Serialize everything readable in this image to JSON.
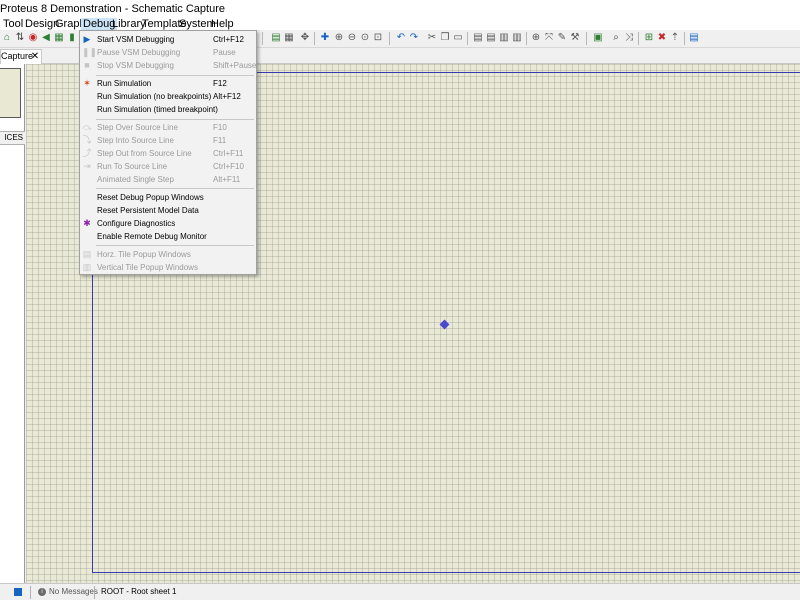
{
  "window": {
    "title": "Proteus 8 Demonstration - Schematic Capture"
  },
  "menubar": {
    "items": [
      {
        "label": "Tool"
      },
      {
        "label": "Design"
      },
      {
        "label": "Graph"
      },
      {
        "label": "Debug"
      },
      {
        "label": "Library"
      },
      {
        "label": "Template"
      },
      {
        "label": "System"
      },
      {
        "label": "Help"
      }
    ]
  },
  "tab": {
    "label": "Capture",
    "close_glyph": "✕"
  },
  "left_pane": {
    "devices_header": "ICES"
  },
  "debug_menu": {
    "items": [
      {
        "label": "Start VSM Debugging",
        "shortcut": "Ctrl+F12",
        "icon": "play-icon",
        "enabled": true
      },
      {
        "label": "Pause VSM Debugging",
        "shortcut": "Pause",
        "icon": "pause-icon",
        "enabled": false
      },
      {
        "label": "Stop VSM Debugging",
        "shortcut": "Shift+Pause",
        "icon": "stop-icon",
        "enabled": false
      },
      {
        "label": "Run Simulation",
        "shortcut": "F12",
        "icon": "run-simulation-icon",
        "enabled": true
      },
      {
        "label": "Run Simulation (no breakpoints)",
        "shortcut": "Alt+F12",
        "icon": "",
        "enabled": true
      },
      {
        "label": "Run Simulation (timed breakpoint)",
        "shortcut": "",
        "icon": "",
        "enabled": true
      },
      {
        "label": "Step Over Source Line",
        "shortcut": "F10",
        "icon": "step-over-icon",
        "enabled": false
      },
      {
        "label": "Step Into Source Line",
        "shortcut": "F11",
        "icon": "step-into-icon",
        "enabled": false
      },
      {
        "label": "Step Out from Source Line",
        "shortcut": "Ctrl+F11",
        "icon": "step-out-icon",
        "enabled": false
      },
      {
        "label": "Run To Source Line",
        "shortcut": "Ctrl+F10",
        "icon": "run-to-line-icon",
        "enabled": false
      },
      {
        "label": "Animated Single Step",
        "shortcut": "Alt+F11",
        "icon": "",
        "enabled": false
      },
      {
        "label": "Reset Debug Popup Windows",
        "shortcut": "",
        "icon": "",
        "enabled": true
      },
      {
        "label": "Reset Persistent Model Data",
        "shortcut": "",
        "icon": "",
        "enabled": true
      },
      {
        "label": "Configure Diagnostics",
        "shortcut": "",
        "icon": "bug-icon",
        "enabled": true
      },
      {
        "label": "Enable Remote Debug Monitor",
        "shortcut": "",
        "icon": "",
        "enabled": true
      },
      {
        "label": "Horz. Tile Popup Windows",
        "shortcut": "",
        "icon": "horz-tile-icon",
        "enabled": false
      },
      {
        "label": "Vertical Tile Popup Windows",
        "shortcut": "",
        "icon": "vert-tile-icon",
        "enabled": false
      }
    ]
  },
  "statusbar": {
    "messages": "No Messages",
    "sheet": "ROOT - Root sheet 1"
  },
  "colors": {
    "canvas": "#e9e9d6",
    "sheet_border": "#3a3ab0",
    "menu_bg": "#f2f2f2",
    "disabled_text": "#9a9a9a"
  }
}
